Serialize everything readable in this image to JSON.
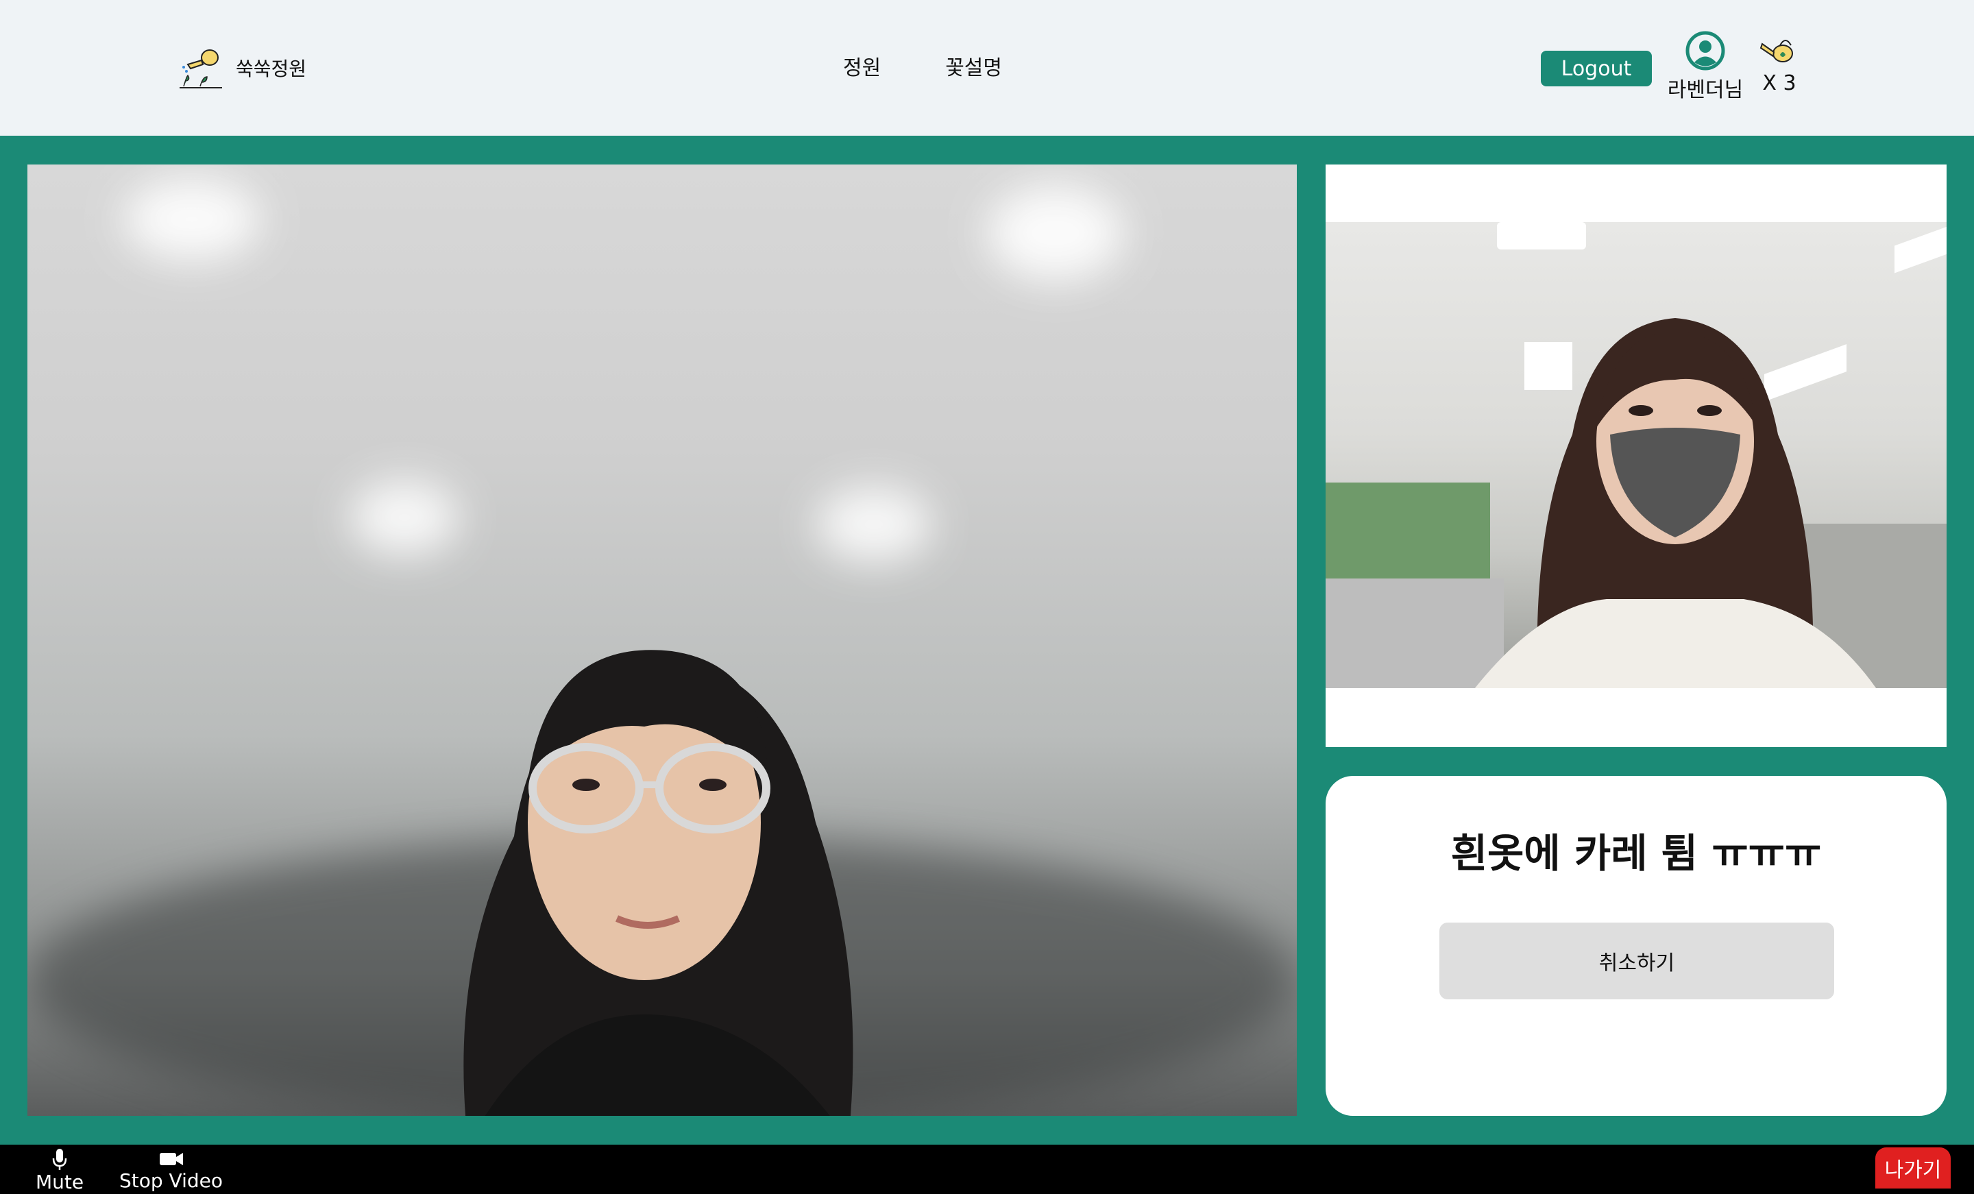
{
  "header": {
    "brand_name": "쑥쑥정원",
    "nav": [
      "정원",
      "꽃설명"
    ],
    "logout_label": "Logout",
    "user_name": "라벤더님",
    "watering_count": "X 3"
  },
  "card": {
    "message": "흰옷에 카레 튐 ㅠㅠㅠ",
    "cancel_label": "취소하기"
  },
  "toolbar": {
    "mute_label": "Mute",
    "stop_video_label": "Stop Video",
    "exit_label": "나가기"
  },
  "colors": {
    "accent": "#1b8a76",
    "header_bg": "#eff3f6",
    "exit": "#e02020",
    "toolbar_bg": "#000000"
  },
  "icons": [
    "watering-can-logo-icon",
    "user-circle-icon",
    "watering-can-icon",
    "microphone-icon",
    "video-camera-icon"
  ]
}
